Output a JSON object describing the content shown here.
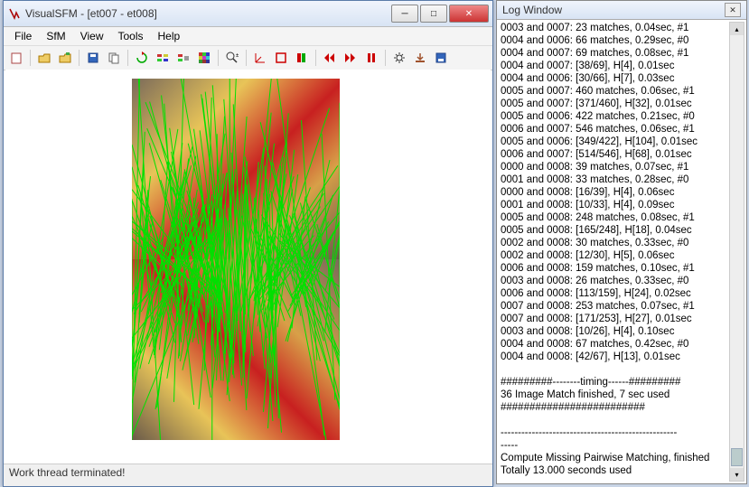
{
  "window": {
    "title": "VisualSFM - [et007 - et008]"
  },
  "menu": {
    "items": [
      "File",
      "SfM",
      "View",
      "Tools",
      "Help"
    ]
  },
  "status": {
    "text": "Work thread terminated!"
  },
  "log": {
    "title": "Log Window",
    "lines": [
      "0003 and 0007: 23 matches, 0.04sec, #1",
      "0004 and 0006: 66 matches, 0.29sec, #0",
      "0004 and 0007: 69 matches, 0.08sec, #1",
      "0004 and 0007: [38/69], H[4], 0.01sec",
      "0004 and 0006: [30/66], H[7], 0.03sec",
      "0005 and 0007: 460 matches, 0.06sec, #1",
      "0005 and 0007: [371/460], H[32], 0.01sec",
      "0005 and 0006: 422 matches, 0.21sec, #0",
      "0006 and 0007: 546 matches, 0.06sec, #1",
      "0005 and 0006: [349/422], H[104], 0.01sec",
      "0006 and 0007: [514/546], H[68], 0.01sec",
      "0000 and 0008: 39 matches, 0.07sec, #1",
      "0001 and 0008: 33 matches, 0.28sec, #0",
      "0000 and 0008: [16/39], H[4], 0.06sec",
      "0001 and 0008: [10/33], H[4], 0.09sec",
      "0005 and 0008: 248 matches, 0.08sec, #1",
      "0005 and 0008: [165/248], H[18], 0.04sec",
      "0002 and 0008: 30 matches, 0.33sec, #0",
      "0002 and 0008: [12/30], H[5], 0.06sec",
      "0006 and 0008: 159 matches, 0.10sec, #1",
      "0003 and 0008: 26 matches, 0.33sec, #0",
      "0006 and 0008: [113/159], H[24], 0.02sec",
      "0007 and 0008: 253 matches, 0.07sec, #1",
      "0007 and 0008: [171/253], H[27], 0.01sec",
      "0003 and 0008: [10/26], H[4], 0.10sec",
      "0004 and 0008: 67 matches, 0.42sec, #0",
      "0004 and 0008: [42/67], H[13], 0.01sec",
      "",
      "#########--------timing------#########",
      "36 Image Match finished, 7 sec used",
      "#########################",
      "",
      "---------------------------------------------------",
      "-----",
      "Compute Missing Pairwise Matching, finished",
      "Totally 13.000 seconds used"
    ]
  },
  "toolbar": {
    "icons": [
      "new",
      "open",
      "open-multi",
      "save",
      "copy",
      "refresh",
      "reconstruct-sparse",
      "reconstruct-resume",
      "dense",
      "zoom",
      "roi",
      "point",
      "stop-sq",
      "marker",
      "play-all",
      "play-fwd",
      "pause",
      "gear",
      "export",
      "disk"
    ]
  }
}
